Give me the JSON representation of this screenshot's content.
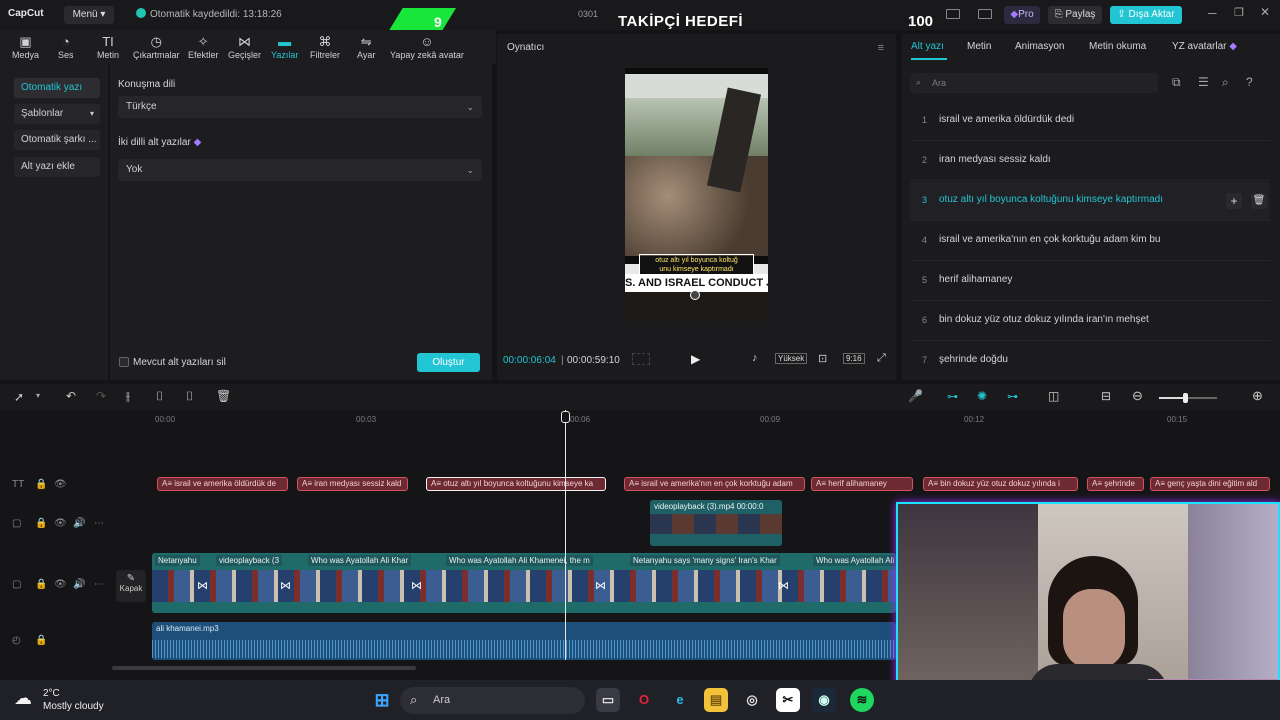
{
  "app": {
    "logo": "CapCut",
    "menu_label": "Menü",
    "autosave": "Otomatik kaydedildi: 13:18:26",
    "project_name": "0301",
    "pro_label": "Pro",
    "share_label": "Paylaş",
    "export_label": "Dışa Aktar"
  },
  "overlay": {
    "follower_title": "TAKİPÇİ HEDEFİ",
    "follower_current": "9",
    "follower_goal": "100"
  },
  "toolbar": {
    "items": [
      {
        "label": "Medya",
        "icon": "media-icon"
      },
      {
        "label": "Ses",
        "icon": "audio-icon"
      },
      {
        "label": "Metin",
        "icon": "text-icon"
      },
      {
        "label": "Çıkartmalar",
        "icon": "sticker-icon"
      },
      {
        "label": "Efektler",
        "icon": "effects-icon"
      },
      {
        "label": "Geçişler",
        "icon": "transitions-icon"
      },
      {
        "label": "Yazılar",
        "icon": "captions-icon"
      },
      {
        "label": "Filtreler",
        "icon": "filters-icon"
      },
      {
        "label": "Ayar",
        "icon": "adjust-icon"
      },
      {
        "label": "Yapay zekâ avatar",
        "icon": "ai-avatar-icon"
      }
    ]
  },
  "left_nav": {
    "items": [
      "Otomatik yazı",
      "Şablonlar",
      "Otomatik şarkı ...",
      "Alt yazı ekle"
    ]
  },
  "settings": {
    "language_label": "Konuşma dili",
    "language_value": "Türkçe",
    "bilingual_label": "İki dilli alt yazılar",
    "bilingual_value": "Yok",
    "remove_existing_label": "Mevcut alt yazıları sil",
    "create_button": "Oluştur"
  },
  "player": {
    "title": "Oynatıcı",
    "current_time": "00:00:06:04",
    "total_time": "00:00:59:10",
    "quality_label": "Yüksek",
    "ratio_label": "9:16",
    "caption_line1": "otuz altı yıl boyunca koltuğ",
    "caption_line2": "unu kimseye kaptırmadı",
    "banner_text": "S. AND ISRAEL CONDUCT JO"
  },
  "right_panel": {
    "tabs": [
      "Alt yazı",
      "Metin",
      "Animasyon",
      "Metin okuma",
      "YZ avatarlar"
    ],
    "search_placeholder": "Ara",
    "subtitles": [
      {
        "num": "1",
        "text": "israil ve amerika öldürdük dedi"
      },
      {
        "num": "2",
        "text": "iran medyası sessiz kaldı"
      },
      {
        "num": "3",
        "text": "otuz altı yıl boyunca koltuğunu kimseye kaptırmadı"
      },
      {
        "num": "4",
        "text": "israil ve amerika'nın en çok korktuğu adam kim bu"
      },
      {
        "num": "5",
        "text": "herif alihamaney"
      },
      {
        "num": "6",
        "text": "bin dokuz yüz otuz dokuz yılında iran'ın mehşet"
      },
      {
        "num": "7",
        "text": "şehrinde doğdu"
      }
    ]
  },
  "timeline": {
    "ticks": [
      "00:00",
      "00:03",
      "00:06",
      "00:09",
      "00:12",
      "00:15"
    ],
    "caption_clips": [
      "israil ve amerika öldürdük de",
      "iran medyası sessiz kald",
      "otuz altı yıl boyunca koltuğunu kimseye ka",
      "israil ve amerika'nın en çok korktuğu adam",
      "herif alihamaney",
      "bin dokuz yüz otuz dokuz yılında i",
      "şehrinde",
      "genç yaşta dini eğitim ald"
    ],
    "overlay_clip": "videoplayback (3).mp4   00:00:0",
    "video_clips": [
      "Netanyahu",
      "videoplayback (3",
      "Who was Ayatollah Ali Khar",
      "Who was Ayatollah Ali Khamenei, the m",
      "Netanyahu says 'many signs' Iran's Khar",
      "Who was Ayatollah Ali"
    ],
    "cover_label": "Kapak",
    "audio_clip": "ali khamanei.mp3"
  },
  "taskbar": {
    "weather_temp": "2°C",
    "weather_desc": "Mostly cloudy",
    "search_label": "Ara"
  },
  "colors": {
    "accent": "#22c5d3",
    "caption_clip": "#6e2a32",
    "caption_border": "#d4525c",
    "video_track": "#1f6b6a",
    "audio_track": "#1d4f7a",
    "goal_green": "#19e63a",
    "webcam_border": "#19e3ff"
  }
}
